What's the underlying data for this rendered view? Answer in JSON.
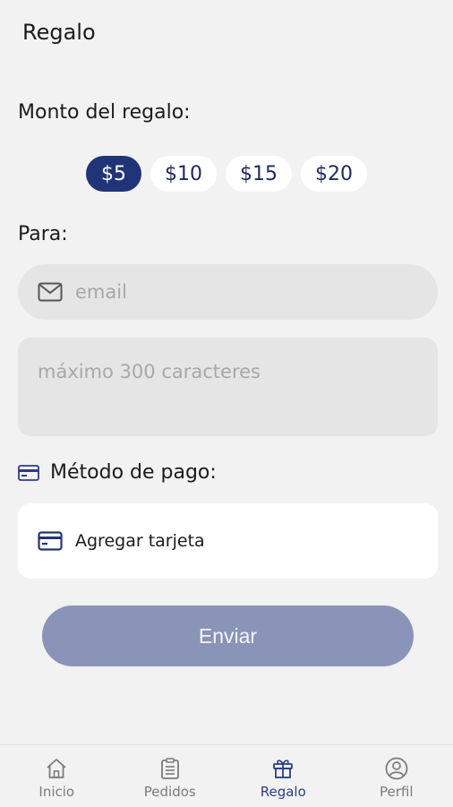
{
  "header": {
    "title": "Regalo"
  },
  "amount": {
    "label": "Monto del regalo:",
    "options": [
      "$5",
      "$10",
      "$15",
      "$20"
    ],
    "selected": "$5"
  },
  "recipient": {
    "label": "Para:",
    "email_placeholder": "email",
    "message_placeholder": "máximo 300 caracteres"
  },
  "payment": {
    "label": "Método de pago:",
    "add_card_label": "Agregar tarjeta"
  },
  "send_button": {
    "label": "Enviar"
  },
  "nav": {
    "items": [
      {
        "label": "Inicio",
        "icon": "home-icon"
      },
      {
        "label": "Pedidos",
        "icon": "clipboard-icon"
      },
      {
        "label": "Regalo",
        "icon": "gift-icon"
      },
      {
        "label": "Perfil",
        "icon": "user-icon"
      }
    ],
    "active": "Regalo"
  },
  "colors": {
    "accent": "#213477",
    "button_disabled": "#8a94b8",
    "background": "#f2f2f2"
  }
}
